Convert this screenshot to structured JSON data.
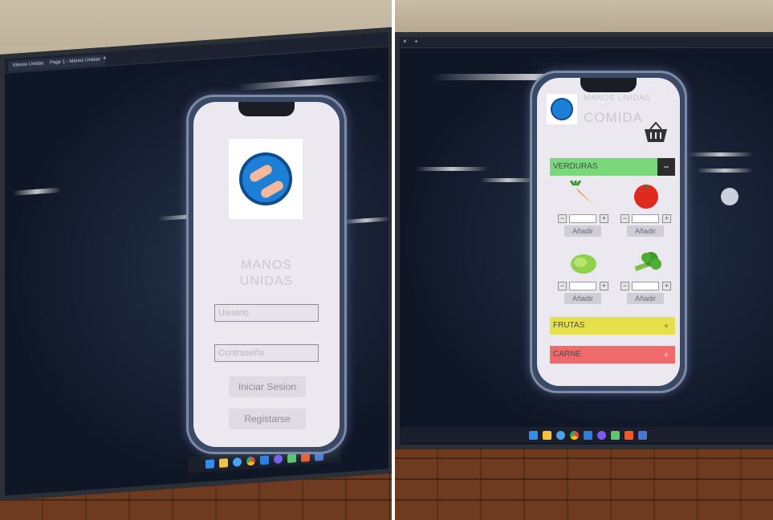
{
  "left_screen": {
    "tabs": [
      "Manos Unidas",
      "Page 1 - Manos Unidas"
    ],
    "app_title_line1": "MANOS",
    "app_title_line2": "UNIDAS",
    "user_placeholder": "Usuario",
    "password_placeholder": "Contraseña",
    "login_button": "Iniciar Sesion",
    "register_button": "Registarse"
  },
  "right_screen": {
    "brand": "MANOS UNIDAS",
    "page_title": "COMIDA",
    "sections": [
      {
        "label": "VERDURAS",
        "toggle": "−",
        "color": "#7bd77b"
      },
      {
        "label": "FRUTAS",
        "toggle": "+",
        "color": "#e6e04a"
      },
      {
        "label": "CARNE",
        "toggle": "+",
        "color": "#ef6b6b"
      }
    ],
    "items": [
      {
        "icon": "carrot-icon",
        "minus": "−",
        "plus": "+",
        "add_label": "Añadir"
      },
      {
        "icon": "tomato-icon",
        "minus": "−",
        "plus": "+",
        "add_label": "Añadir"
      },
      {
        "icon": "lettuce-icon",
        "minus": "−",
        "plus": "+",
        "add_label": "Añadir"
      },
      {
        "icon": "broccoli-icon",
        "minus": "−",
        "plus": "+",
        "add_label": "Añadir"
      }
    ],
    "basket_icon": "basket-icon"
  },
  "colors": {
    "screen_bg": "#121a2a",
    "phone_screen": "#ebe8f0",
    "verduras": "#7bd77b",
    "frutas": "#e6e04a",
    "carne": "#ef6b6b"
  }
}
